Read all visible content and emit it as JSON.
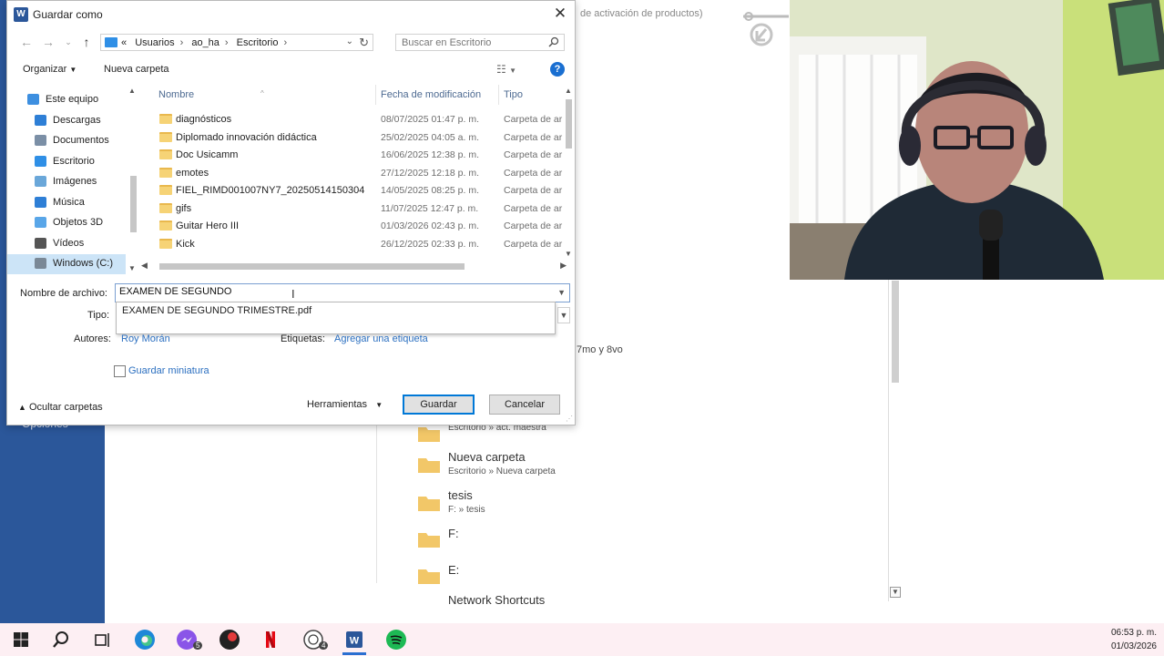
{
  "background": {
    "sidebar_text": "Opciones",
    "activation_text": "de activación de productos)",
    "bg_snippet": "7mo y 8vo",
    "recent_folders": [
      {
        "name": "",
        "path": "Escritorio » act. maestra"
      },
      {
        "name": "Nueva carpeta",
        "path": "Escritorio » Nueva carpeta"
      },
      {
        "name": "tesis",
        "path": "F: » tesis"
      },
      {
        "name": "F:",
        "path": ""
      },
      {
        "name": "E:",
        "path": ""
      },
      {
        "name": "Network Shortcuts",
        "path": ""
      }
    ]
  },
  "dialog": {
    "title": "Guardar como",
    "app_icon_letter": "W",
    "close_label": "✕",
    "address": {
      "prefix": "«",
      "crumbs": [
        "Usuarios",
        "ao_ha",
        "Escritorio"
      ]
    },
    "search_placeholder": "Buscar en Escritorio",
    "toolbar": {
      "organize": "Organizar",
      "new_folder": "Nueva carpeta",
      "help": "?"
    },
    "nav_items": [
      {
        "label": "Este equipo",
        "icon": "computer-icon",
        "color": "#3d8fe0"
      },
      {
        "label": "Descargas",
        "icon": "download-icon",
        "color": "#2e7fd6"
      },
      {
        "label": "Documentos",
        "icon": "documents-icon",
        "color": "#7b8fa6"
      },
      {
        "label": "Escritorio",
        "icon": "desktop-icon",
        "color": "#2f8fe6"
      },
      {
        "label": "Imágenes",
        "icon": "pictures-icon",
        "color": "#6aa7d9"
      },
      {
        "label": "Música",
        "icon": "music-icon",
        "color": "#2e7fd6"
      },
      {
        "label": "Objetos 3D",
        "icon": "objects3d-icon",
        "color": "#59a6e8"
      },
      {
        "label": "Vídeos",
        "icon": "videos-icon",
        "color": "#555555"
      },
      {
        "label": "Windows (C:)",
        "icon": "drive-icon",
        "color": "#7a8896"
      }
    ],
    "columns": {
      "name": "Nombre",
      "modified": "Fecha de modificación",
      "type": "Tipo"
    },
    "files": [
      {
        "name": "diagnósticos",
        "date": "08/07/2025 01:47 p. m.",
        "type": "Carpeta de ar"
      },
      {
        "name": "Diplomado innovación didáctica",
        "date": "25/02/2025 04:05 a. m.",
        "type": "Carpeta de ar"
      },
      {
        "name": "Doc Usicamm",
        "date": "16/06/2025 12:38 p. m.",
        "type": "Carpeta de ar"
      },
      {
        "name": "emotes",
        "date": "27/12/2025 12:18 p. m.",
        "type": "Carpeta de ar"
      },
      {
        "name": "FIEL_RIMD001007NY7_20250514150304",
        "date": "14/05/2025 08:25 p. m.",
        "type": "Carpeta de ar"
      },
      {
        "name": "gifs",
        "date": "11/07/2025 12:47 p. m.",
        "type": "Carpeta de ar"
      },
      {
        "name": "Guitar Hero III",
        "date": "01/03/2026 02:43 p. m.",
        "type": "Carpeta de ar"
      },
      {
        "name": "Kick",
        "date": "26/12/2025 02:33 p. m.",
        "type": "Carpeta de ar"
      }
    ],
    "form": {
      "filename_label": "Nombre de archivo:",
      "filename_value": "EXAMEN DE SEGUNDO",
      "suggestion": "EXAMEN DE SEGUNDO TRIMESTRE.pdf",
      "type_label": "Tipo:",
      "authors_label": "Autores:",
      "authors_value": "Roy Morán",
      "tags_label": "Etiquetas:",
      "tags_value": "Agregar una etiqueta",
      "thumbnail_label": "Guardar miniatura"
    },
    "footer": {
      "hide_folders": "Ocultar carpetas",
      "tools": "Herramientas",
      "save": "Guardar",
      "cancel": "Cancelar"
    }
  },
  "taskbar": {
    "time": "06:53 p. m.",
    "date": "01/03/2026",
    "badges": {
      "messenger": "5",
      "whatsapp": "4"
    }
  }
}
